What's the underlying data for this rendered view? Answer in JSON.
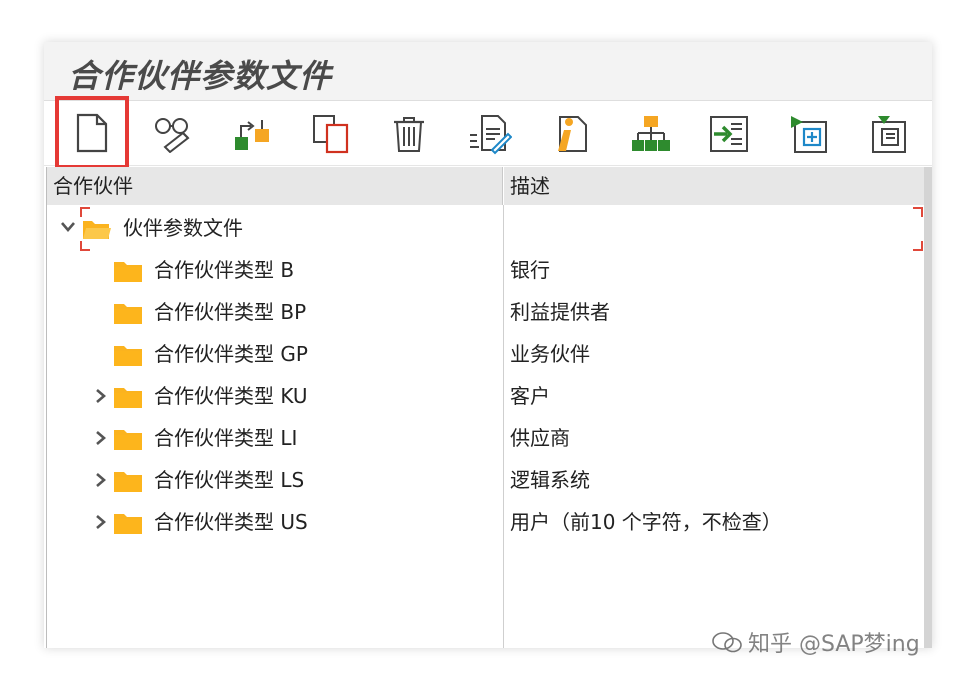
{
  "window": {
    "title": "合作伙伴参数文件"
  },
  "toolbar": {
    "buttons": [
      {
        "icon": "new-document-icon"
      },
      {
        "icon": "display-glasses-icon"
      },
      {
        "icon": "hierarchy-change-icon"
      },
      {
        "icon": "copy-icon"
      },
      {
        "icon": "delete-trash-icon"
      },
      {
        "icon": "edit-document-icon"
      },
      {
        "icon": "info-document-icon"
      },
      {
        "icon": "org-structure-icon"
      },
      {
        "icon": "transfer-icon"
      },
      {
        "icon": "expand-all-icon"
      },
      {
        "icon": "collapse-all-icon"
      }
    ]
  },
  "table": {
    "columns": [
      "合作伙伴",
      "描述"
    ],
    "root": {
      "label": "伙伴参数文件",
      "desc": ""
    },
    "rows": [
      {
        "label": "合作伙伴类型 B",
        "desc": "银行",
        "expandable": false
      },
      {
        "label": "合作伙伴类型 BP",
        "desc": "利益提供者",
        "expandable": false
      },
      {
        "label": "合作伙伴类型 GP",
        "desc": "业务伙伴",
        "expandable": false
      },
      {
        "label": "合作伙伴类型 KU",
        "desc": "客户",
        "expandable": true
      },
      {
        "label": "合作伙伴类型 LI",
        "desc": "供应商",
        "expandable": true
      },
      {
        "label": "合作伙伴类型 LS",
        "desc": "逻辑系统",
        "expandable": true
      },
      {
        "label": "合作伙伴类型 US",
        "desc": "用户（前10 个字符，不检查）",
        "expandable": true
      }
    ]
  },
  "watermark": {
    "text": "知乎 @SAP梦ing"
  },
  "colors": {
    "folder": "#fbb31e",
    "highlight": "#e53935",
    "green": "#2e8b2e",
    "orange": "#f5a623"
  }
}
